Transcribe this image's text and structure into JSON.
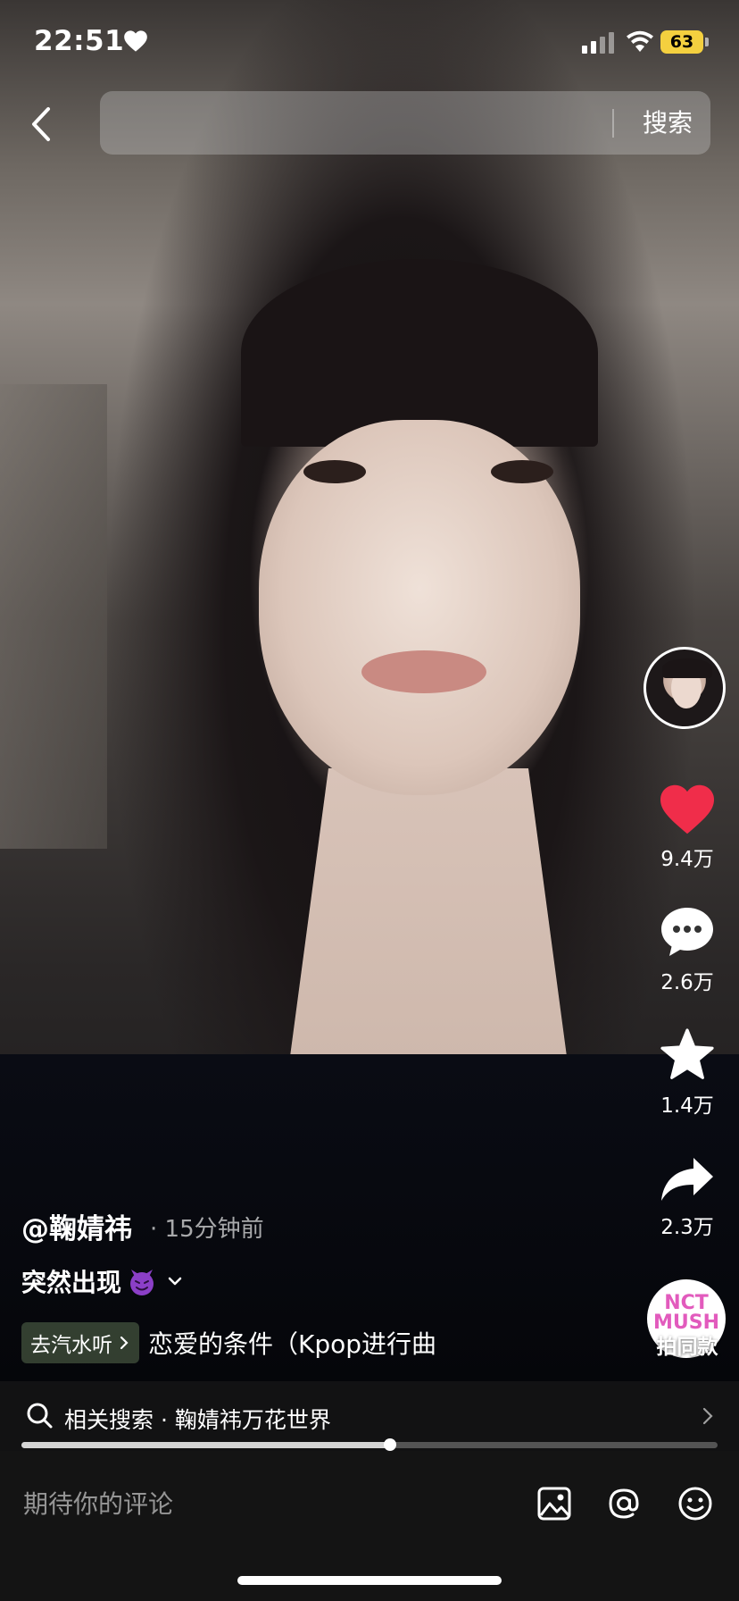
{
  "status_bar": {
    "time": "22:51",
    "battery": "63",
    "battery_color": "#f4d03f",
    "icons": [
      "heart-icon",
      "signal-icon",
      "wifi-icon",
      "battery-icon"
    ]
  },
  "header": {
    "search_placeholder": "",
    "search_button": "搜索"
  },
  "actions": {
    "like_count": "9.4万",
    "comment_count": "2.6万",
    "favorite_count": "1.4万",
    "share_count": "2.3万",
    "same_style_label": "拍同款",
    "same_style_disc": "NCT MUSH",
    "like_color": "#f02d4a"
  },
  "post": {
    "author": "@鞠婧祎",
    "time": "· 15分钟前",
    "caption": "突然出现",
    "music_tag": "去汽水听",
    "song": "恋爱的条件（Kpop进行曲"
  },
  "related": {
    "text": "相关搜索 · 鞠婧祎万花世界"
  },
  "progress": {
    "fraction": 0.53
  },
  "comment_bar": {
    "placeholder": "期待你的评论"
  }
}
